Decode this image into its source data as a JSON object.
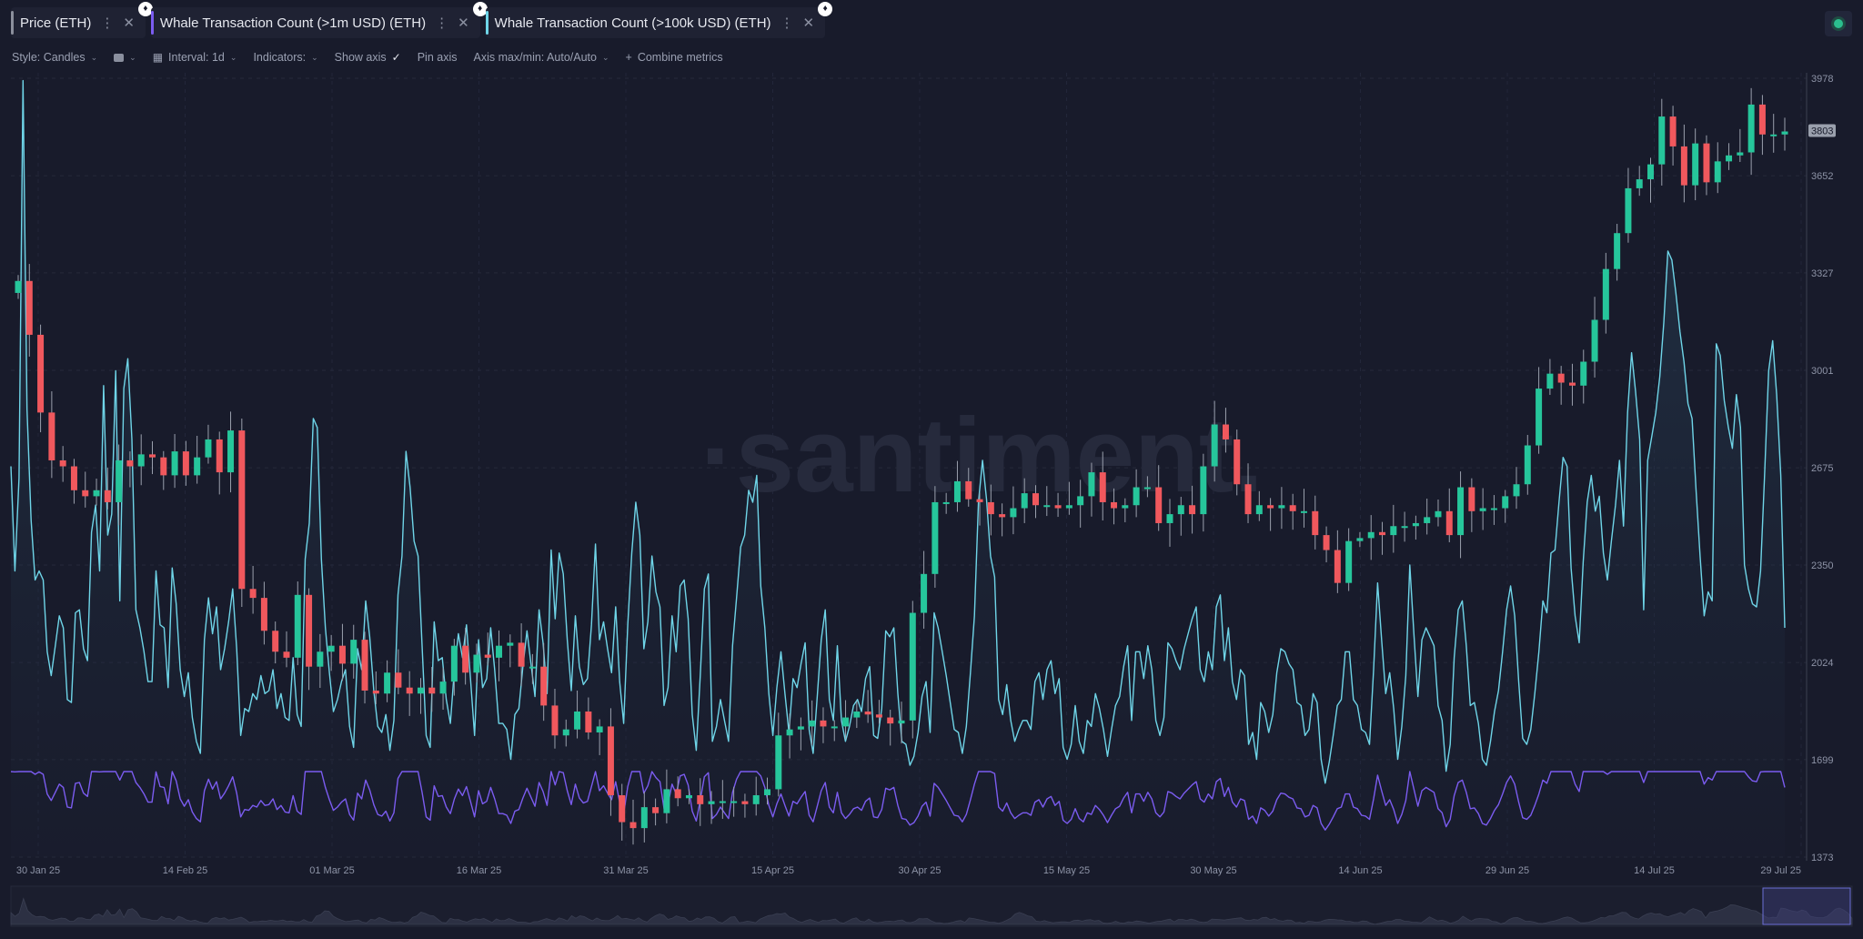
{
  "tabs": [
    {
      "label": "Price (ETH)",
      "color": "#8b8f9c"
    },
    {
      "label": "Whale Transaction Count (>1m USD) (ETH)",
      "color": "#7b5cf0"
    },
    {
      "label": "Whale Transaction Count (>100k USD) (ETH)",
      "color": "#6fd5e8"
    }
  ],
  "toolbar": {
    "style": "Style: Candles",
    "interval": "Interval: 1d",
    "indicators": "Indicators:",
    "show_axis": "Show axis",
    "pin_axis": "Pin axis",
    "axis_maxmin": "Axis max/min: Auto/Auto",
    "combine": "Combine metrics"
  },
  "watermark": "·santiment.",
  "colors": {
    "up": "#26c69b",
    "down": "#f0585d",
    "whale100k": "#6fd5e8",
    "whale1m": "#7b5cf0",
    "background": "#181b2b"
  },
  "chart_data": {
    "type": "candlestick+line",
    "y_axis": {
      "ticks": [
        1373,
        1699,
        2024,
        2350,
        2675,
        3001,
        3327,
        3652,
        3978
      ],
      "range": [
        1373,
        3978
      ],
      "last_price_label": "3803"
    },
    "x_axis": {
      "ticks": [
        "30 Jan 25",
        "14 Feb 25",
        "01 Mar 25",
        "16 Mar 25",
        "31 Mar 25",
        "15 Apr 25",
        "30 Apr 25",
        "15 May 25",
        "30 May 25",
        "14 Jun 25",
        "29 Jun 25",
        "14 Jul 25",
        "29 Jul 25"
      ]
    },
    "candles_close": [
      3300,
      3120,
      2860,
      2700,
      2680,
      2600,
      2580,
      2600,
      2560,
      2700,
      2680,
      2720,
      2710,
      2650,
      2730,
      2650,
      2710,
      2770,
      2660,
      2800,
      2270,
      2240,
      2130,
      2060,
      2040,
      2250,
      2010,
      2060,
      2080,
      2020,
      2100,
      1930,
      1920,
      1990,
      1940,
      1920,
      1940,
      1920,
      1960,
      2080,
      1990,
      2050,
      2040,
      2080,
      2090,
      2010,
      2010,
      1880,
      1780,
      1800,
      1860,
      1790,
      1810,
      1580,
      1490,
      1470,
      1540,
      1520,
      1600,
      1570,
      1580,
      1550,
      1560,
      1560,
      1560,
      1550,
      1580,
      1600,
      1780,
      1800,
      1810,
      1830,
      1810,
      1810,
      1840,
      1860,
      1850,
      1840,
      1820,
      1830,
      2190,
      2320,
      2560,
      2560,
      2630,
      2570,
      2560,
      2520,
      2510,
      2540,
      2590,
      2550,
      2550,
      2540,
      2550,
      2580,
      2660,
      2560,
      2540,
      2550,
      2610,
      2610,
      2490,
      2520,
      2550,
      2520,
      2680,
      2820,
      2770,
      2620,
      2520,
      2550,
      2540,
      2550,
      2530,
      2530,
      2450,
      2400,
      2290,
      2430,
      2440,
      2460,
      2450,
      2480,
      2480,
      2490,
      2510,
      2530,
      2450,
      2610,
      2530,
      2540,
      2540,
      2580,
      2620,
      2750,
      2940,
      2990,
      2960,
      2950,
      3030,
      3170,
      3340,
      3460,
      3610,
      3640,
      3690,
      3850,
      3750,
      3620,
      3760,
      3630,
      3700,
      3720,
      3730,
      3890,
      3790,
      3790,
      3800
    ],
    "whale_100k": [
      2680,
      2330,
      2640,
      3970,
      2870,
      2500,
      2300,
      2330,
      2300,
      2060,
      1980,
      2080,
      2180,
      2140,
      1900,
      1890,
      2190,
      2200,
      2070,
      2030,
      2460,
      2550,
      2330,
      2950,
      2450,
      2520,
      3000,
      2230,
      2940,
      3040,
      2770,
      2200,
      2140,
      2060,
      1960,
      1960,
      2330,
      2150,
      2140,
      1940,
      2340,
      2220,
      2000,
      1910,
      1990,
      1840,
      1760,
      1720,
      2100,
      2240,
      2120,
      2210,
      2000,
      2070,
      2160,
      2270,
      2070,
      1780,
      1870,
      1860,
      1920,
      1900,
      1980,
      1920,
      1930,
      2000,
      1870,
      1920,
      1840,
      1830,
      2040,
      1850,
      1810,
      2370,
      2490,
      2840,
      2810,
      2370,
      2140,
      1990,
      1860,
      1900,
      1960,
      2000,
      1810,
      1740,
      2070,
      2000,
      2230,
      2110,
      1930,
      1810,
      1790,
      1850,
      1730,
      1830,
      2250,
      2380,
      2730,
      2610,
      2430,
      2380,
      2080,
      1780,
      1740,
      2160,
      2030,
      2040,
      1900,
      1820,
      2000,
      2120,
      2040,
      2150,
      1970,
      1780,
      2100,
      1940,
      1970,
      2140,
      2000,
      1820,
      1820,
      1800,
      1700,
      1850,
      1870,
      2010,
      2130,
      2020,
      1910,
      2200,
      2090,
      1920,
      2400,
      2170,
      2390,
      2320,
      2100,
      1930,
      2180,
      2010,
      1950,
      1970,
      2150,
      2420,
      2100,
      2160,
      2070,
      1990,
      2210,
      1960,
      1820,
      2150,
      2390,
      2560,
      2450,
      2070,
      2160,
      2380,
      2260,
      2210,
      1880,
      1940,
      2180,
      2060,
      2280,
      2300,
      2170,
      1850,
      1730,
      1980,
      2270,
      2320,
      1760,
      1810,
      1900,
      1830,
      1760,
      2080,
      2240,
      2410,
      2450,
      2600,
      2560,
      2650,
      2280,
      2140,
      1920,
      1780,
      1940,
      2060,
      1920,
      1790,
      1970,
      1940,
      2020,
      2090,
      1800,
      1720,
      1910,
      2100,
      2200,
      1900,
      1830,
      2080,
      1830,
      1760,
      1810,
      1880,
      1900,
      1860,
      1970,
      2010,
      1780,
      1770,
      1870,
      2130,
      2110,
      2140,
      1920,
      1760,
      1750,
      1680,
      1710,
      1790,
      1910,
      1960,
      1790,
      2190,
      2140,
      2060,
      1980,
      1890,
      1800,
      1790,
      1720,
      1810,
      1990,
      2180,
      2560,
      2700,
      2570,
      2380,
      2310,
      1900,
      1850,
      1950,
      1830,
      1760,
      1800,
      1830,
      1830,
      1800,
      1960,
      1990,
      1900,
      2000,
      2030,
      1920,
      1970,
      1740,
      1700,
      1750,
      1880,
      1760,
      1720,
      1830,
      1810,
      1920,
      1870,
      1800,
      1710,
      1800,
      1880,
      1910,
      2010,
      2080,
      1830,
      2060,
      2060,
      1970,
      2080,
      2000,
      1830,
      1780,
      1840,
      2090,
      2070,
      2030,
      2000,
      2070,
      2120,
      2170,
      2210,
      2000,
      1960,
      2060,
      2000,
      2210,
      2250,
      2030,
      2140,
      1960,
      1900,
      2000,
      1980,
      1750,
      1790,
      1700,
      1890,
      1860,
      1790,
      1850,
      1990,
      2070,
      2060,
      2020,
      2000,
      1890,
      1880,
      1780,
      1800,
      1920,
      1890,
      1700,
      1620,
      1690,
      1780,
      1880,
      1900,
      2060,
      2060,
      1900,
      1880,
      1800,
      1790,
      1750,
      2000,
      2290,
      2100,
      1920,
      1990,
      1870,
      1700,
      1810,
      1980,
      2350,
      2120,
      1910,
      2100,
      2140,
      2110,
      2080,
      1880,
      1830,
      1660,
      1750,
      2040,
      2200,
      2230,
      2080,
      1880,
      1890,
      1820,
      1700,
      1680,
      1760,
      1860,
      1930,
      2060,
      2200,
      2280,
      2180,
      1960,
      1770,
      1750,
      1800,
      1920,
      2060,
      2230,
      2190,
      2390,
      2400,
      2560,
      2710,
      2680,
      2340,
      2180,
      2090,
      2360,
      2560,
      2650,
      2530,
      2580,
      2390,
      2300,
      2430,
      2550,
      2700,
      2480,
      2860,
      3060,
      2930,
      2770,
      2200,
      2700,
      2780,
      2860,
      2980,
      3160,
      3400,
      3370,
      3260,
      3130,
      3030,
      2890,
      2840,
      2600,
      2380,
      2180,
      2260,
      2230,
      3090,
      3050,
      2900,
      2810,
      2740,
      2920,
      2810,
      2350,
      2270,
      2220,
      2210,
      2330,
      2650,
      3000,
      3100,
      2920,
      2650,
      2140
    ],
    "whale_1m": []
  }
}
